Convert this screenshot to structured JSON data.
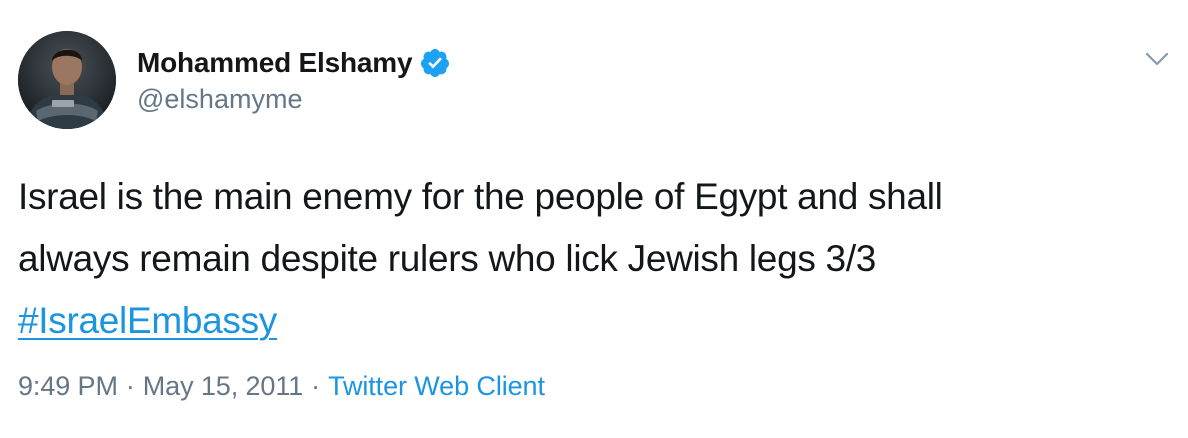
{
  "author": {
    "display_name": "Mohammed Elshamy",
    "handle": "@elshamyme",
    "verified": true
  },
  "tweet": {
    "text_line_1": "Israel is the main enemy for the people of Egypt and shall",
    "text_line_2": "always remain despite rulers who lick Jewish legs 3/3",
    "hashtag": "#IsraelEmbassy"
  },
  "meta": {
    "time": "9:49 PM",
    "separator": "·",
    "date": "May 15, 2011",
    "source": "Twitter Web Client"
  },
  "icons": {
    "verified": "verified-badge-icon",
    "more": "chevron-down-icon",
    "avatar": "profile-photo"
  },
  "colors": {
    "text": "#14171a",
    "secondary": "#657786",
    "link": "#1b95e0",
    "verified": "#1da1f2"
  }
}
